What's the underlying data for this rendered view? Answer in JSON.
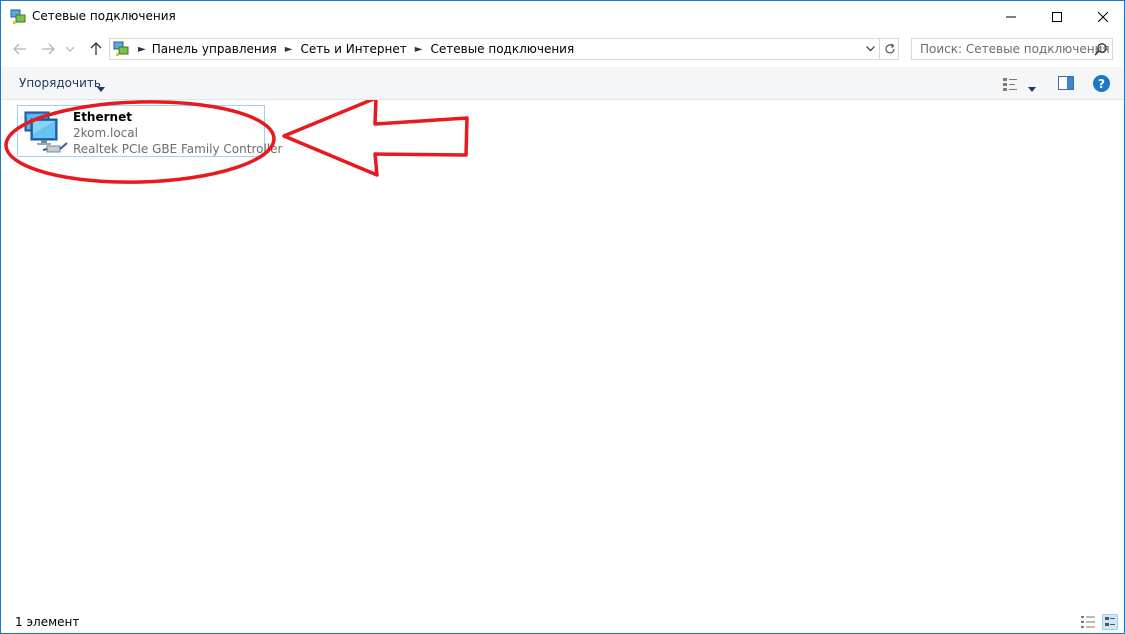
{
  "window": {
    "title": "Сетевые подключения",
    "icon": "network-connections-icon"
  },
  "address_bar": {
    "breadcrumbs": [
      "Панель управления",
      "Сеть и Интернет",
      "Сетевые подключения"
    ],
    "search_placeholder": "Поиск: Сетевые подключения"
  },
  "command_bar": {
    "organize_label": "Упорядочить"
  },
  "connections": [
    {
      "name": "Ethernet",
      "network": "2kom.local",
      "adapter": "Realtek PCIe GBE Family Controller",
      "icon": "ethernet-adapter-icon"
    }
  ],
  "status_bar": {
    "item_count": "1 элемент"
  },
  "colors": {
    "annotation_red": "#e8191f",
    "selection_border": "#9ed2f0",
    "accent_blue": "#1e78c8"
  }
}
